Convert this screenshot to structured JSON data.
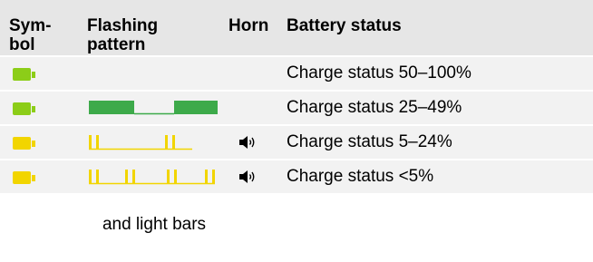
{
  "header": {
    "symbol": "Sym-\nbol",
    "flashing": "Flashing\npattern",
    "horn": "Horn",
    "battery": "Battery status"
  },
  "rows": [
    {
      "status": "Charge status 50–100%",
      "color": "#8ccd18",
      "pattern": "none",
      "horn": false
    },
    {
      "status": "Charge status 25–49%",
      "color": "#8ccd18",
      "pattern": "slow-blocks",
      "pattern_color": "#3daa4a",
      "horn": false
    },
    {
      "status": "Charge status 5–24%",
      "color": "#f2d500",
      "pattern": "double-blink",
      "pattern_color": "#f2d500",
      "horn": true
    },
    {
      "status": "Charge status <5%",
      "color": "#f2d500",
      "pattern": "fast-double-blink",
      "pattern_color": "#f2d500",
      "horn": true
    }
  ],
  "note": "and light bars",
  "icons": {
    "battery": "battery-icon",
    "horn": "horn-speaker-icon"
  }
}
